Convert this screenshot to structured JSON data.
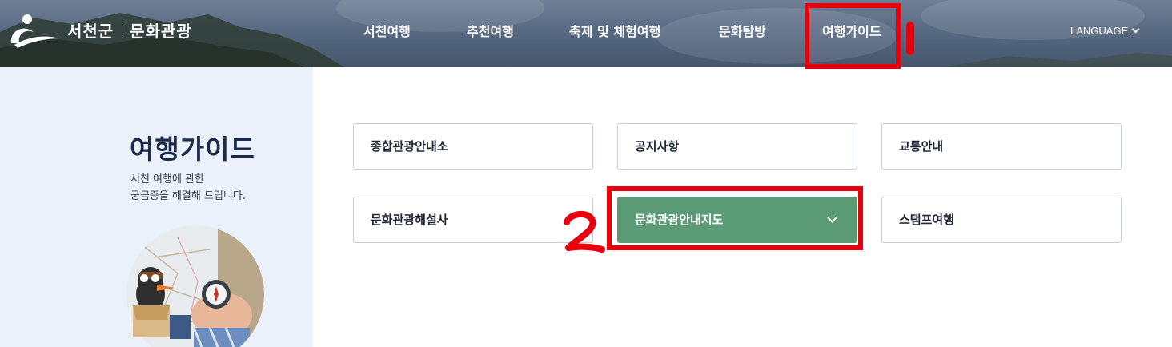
{
  "header": {
    "logo_name": "서천군",
    "logo_sub": "문화관광",
    "nav": [
      {
        "label": "서천여행"
      },
      {
        "label": "추천여행"
      },
      {
        "label": "축제 및 체험여행"
      },
      {
        "label": "문화탐방"
      },
      {
        "label": "여행가이드"
      }
    ],
    "language": "LANGUAGE"
  },
  "sidebar": {
    "title": "여행가이드",
    "desc_line1": "서천 여행에 관한",
    "desc_line2": "궁금증을 해결해 드립니다."
  },
  "menu": [
    {
      "label": "종합관광안내소"
    },
    {
      "label": "공지사항"
    },
    {
      "label": "교통안내"
    },
    {
      "label": "문화관광해설사"
    },
    {
      "label": "문화관광안내지도",
      "active": true
    },
    {
      "label": "스탬프여행"
    }
  ],
  "colors": {
    "accent": "#5a9a74",
    "annotation": "#e8000d",
    "side_bg": "#eaf1fb",
    "title": "#1c2b4a"
  },
  "icons": [
    "logo-mark-icon",
    "chevron-down-icon"
  ]
}
